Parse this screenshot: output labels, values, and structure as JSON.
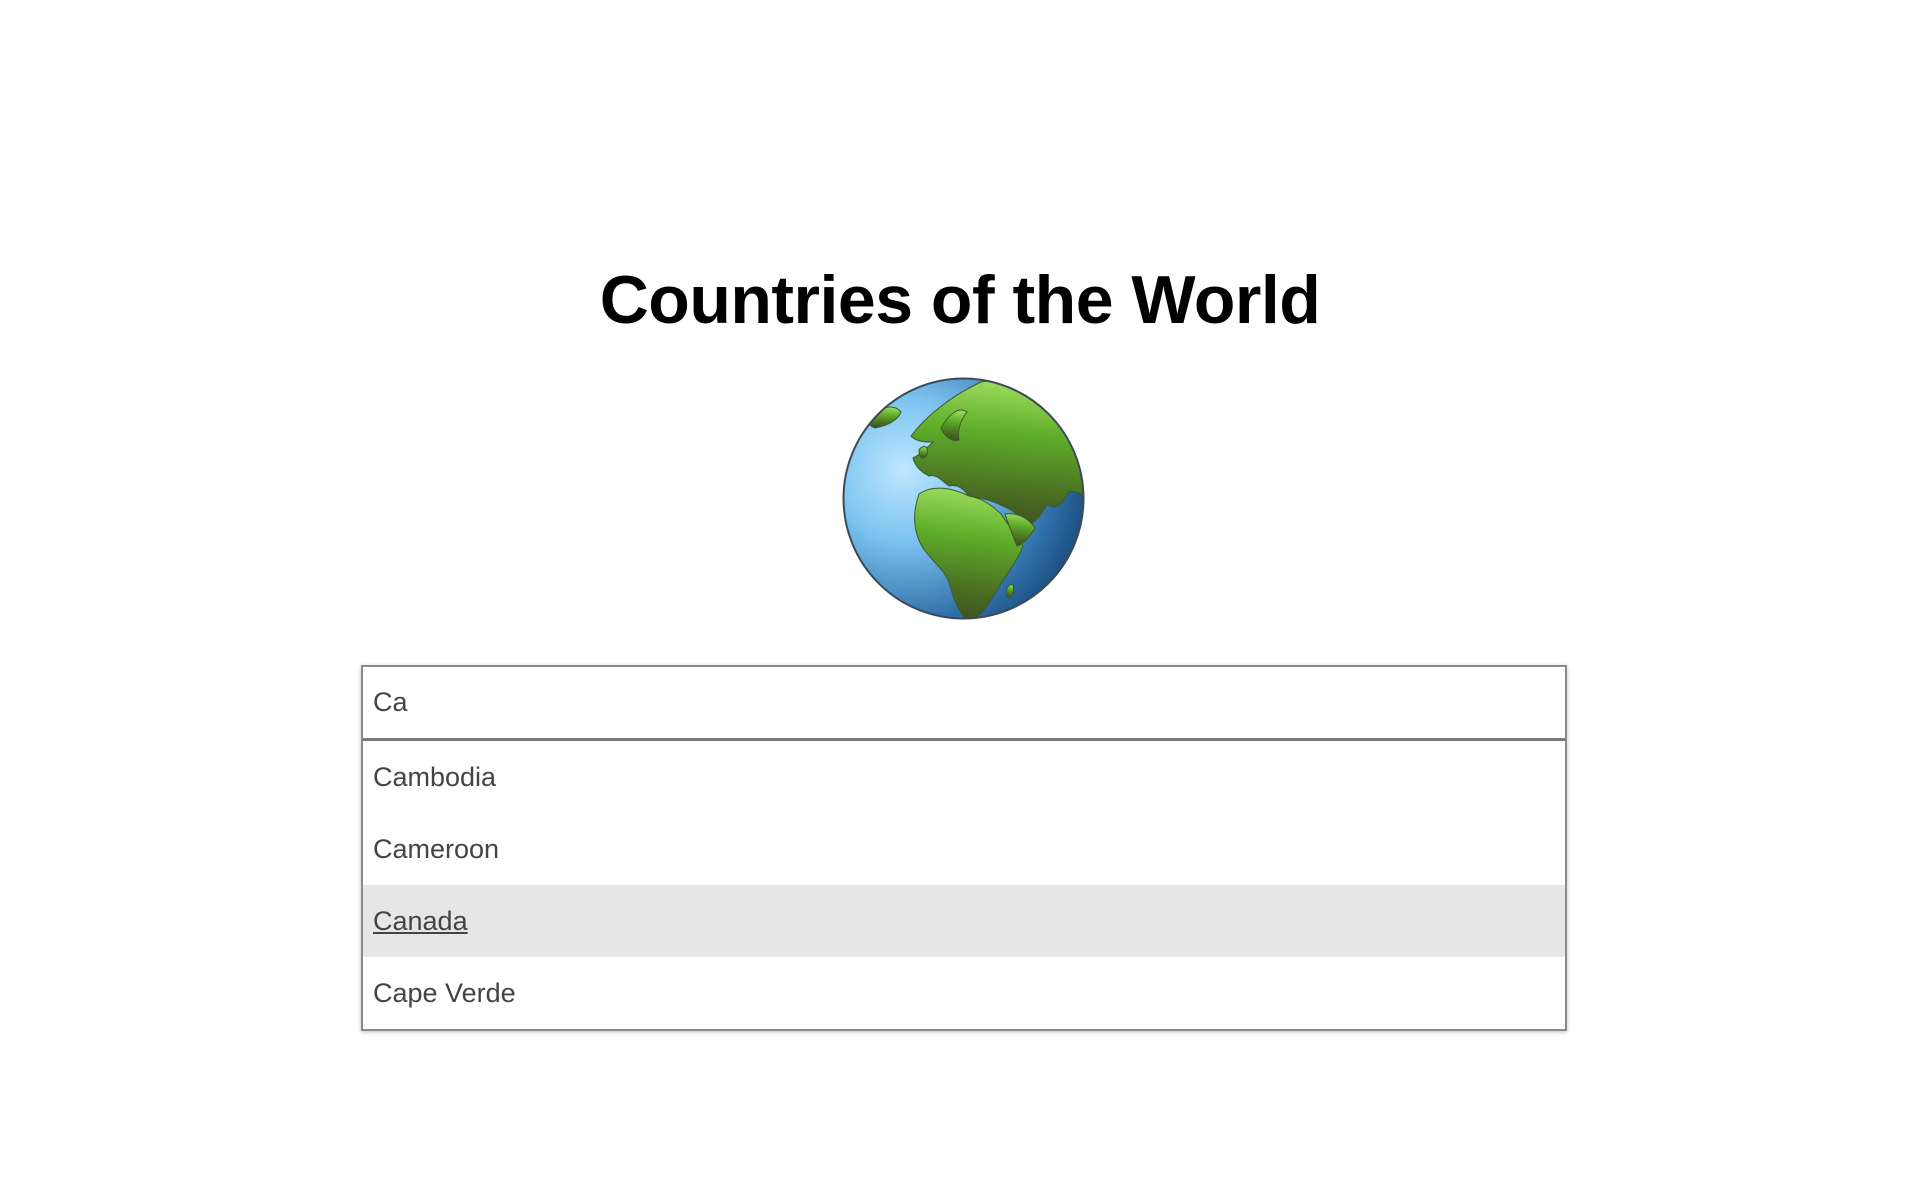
{
  "page": {
    "title": "Countries of the World",
    "logo_icon": "globe-europe-africa-icon"
  },
  "search": {
    "value": "Ca"
  },
  "suggestions": {
    "items": [
      {
        "label": "Cambodia",
        "active": false
      },
      {
        "label": "Cameroon",
        "active": false
      },
      {
        "label": "Canada",
        "active": true
      },
      {
        "label": "Cape Verde",
        "active": false
      }
    ]
  },
  "colors": {
    "highlight": "#e6e6e6",
    "text": "#444444",
    "title": "#000000",
    "border": "#8a8a8a"
  }
}
